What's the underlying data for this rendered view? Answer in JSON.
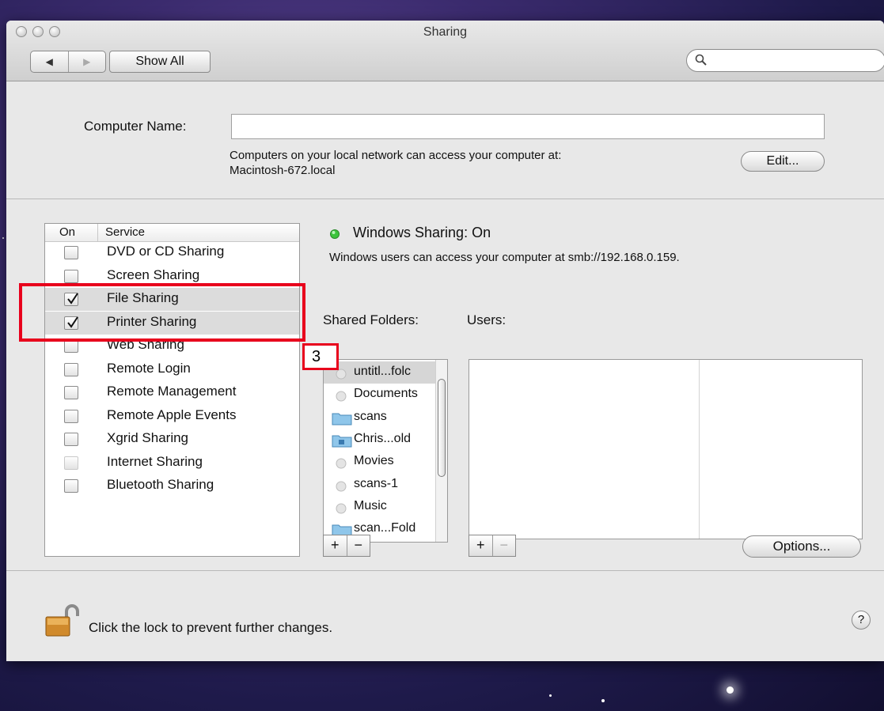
{
  "window": {
    "title": "Sharing"
  },
  "toolbar": {
    "back_label": "◀",
    "forward_label": "▶",
    "show_all_label": "Show All",
    "search_placeholder": ""
  },
  "computer_name": {
    "label": "Computer Name:",
    "value": "",
    "info_line1": "Computers on your local network can access your computer at:",
    "info_line2": "Macintosh-672.local",
    "edit_label": "Edit..."
  },
  "services": {
    "col_on": "On",
    "col_service": "Service",
    "items": [
      {
        "label": "DVD or CD Sharing",
        "checked": false
      },
      {
        "label": "Screen Sharing",
        "checked": false
      },
      {
        "label": "File Sharing",
        "checked": true
      },
      {
        "label": "Printer Sharing",
        "checked": true
      },
      {
        "label": "Web Sharing",
        "checked": false
      },
      {
        "label": "Remote Login",
        "checked": false
      },
      {
        "label": "Remote Management",
        "checked": false
      },
      {
        "label": "Remote Apple Events",
        "checked": false
      },
      {
        "label": "Xgrid Sharing",
        "checked": false
      },
      {
        "label": "Internet Sharing",
        "checked": false
      },
      {
        "label": "Bluetooth Sharing",
        "checked": false
      }
    ]
  },
  "status": {
    "title": "Windows Sharing: On",
    "description": "Windows users can access your computer at smb://192.168.0.159.",
    "indicator_color": "#3cc43c"
  },
  "shared_folders": {
    "label": "Shared Folders:",
    "items": [
      "untitl...folc",
      "Documents",
      "scans",
      "Chris...old",
      "Movies",
      "scans-1",
      "Music",
      "scan...Fold"
    ]
  },
  "users": {
    "label": "Users:"
  },
  "buttons": {
    "plus": "+",
    "minus": "−",
    "options_label": "Options..."
  },
  "annotation": {
    "callout": "3",
    "highlight_color": "#e8001c"
  },
  "footer": {
    "lock_text": "Click the lock to prevent further changes.",
    "help_label": "?"
  }
}
